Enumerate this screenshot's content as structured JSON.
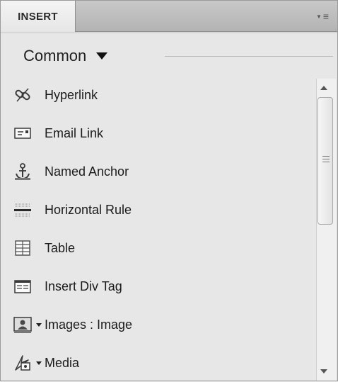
{
  "panel": {
    "tab_label": "INSERT",
    "menu_icon": "panel-options-icon"
  },
  "category": {
    "selected": "Common",
    "caret_icon": "caret-down-icon"
  },
  "items": [
    {
      "label": "Hyperlink",
      "icon": "hyperlink-icon",
      "has_dropdown": false
    },
    {
      "label": "Email Link",
      "icon": "email-link-icon",
      "has_dropdown": false
    },
    {
      "label": "Named Anchor",
      "icon": "anchor-icon",
      "has_dropdown": false
    },
    {
      "label": "Horizontal Rule",
      "icon": "horizontal-rule-icon",
      "has_dropdown": false
    },
    {
      "label": "Table",
      "icon": "table-icon",
      "has_dropdown": false
    },
    {
      "label": "Insert Div Tag",
      "icon": "div-tag-icon",
      "has_dropdown": false
    },
    {
      "label": "Images : Image",
      "icon": "image-icon",
      "has_dropdown": true
    },
    {
      "label": "Media",
      "icon": "media-icon",
      "has_dropdown": true
    }
  ],
  "scrollbar": {
    "up_icon": "scroll-up-icon",
    "down_icon": "scroll-down-icon"
  }
}
